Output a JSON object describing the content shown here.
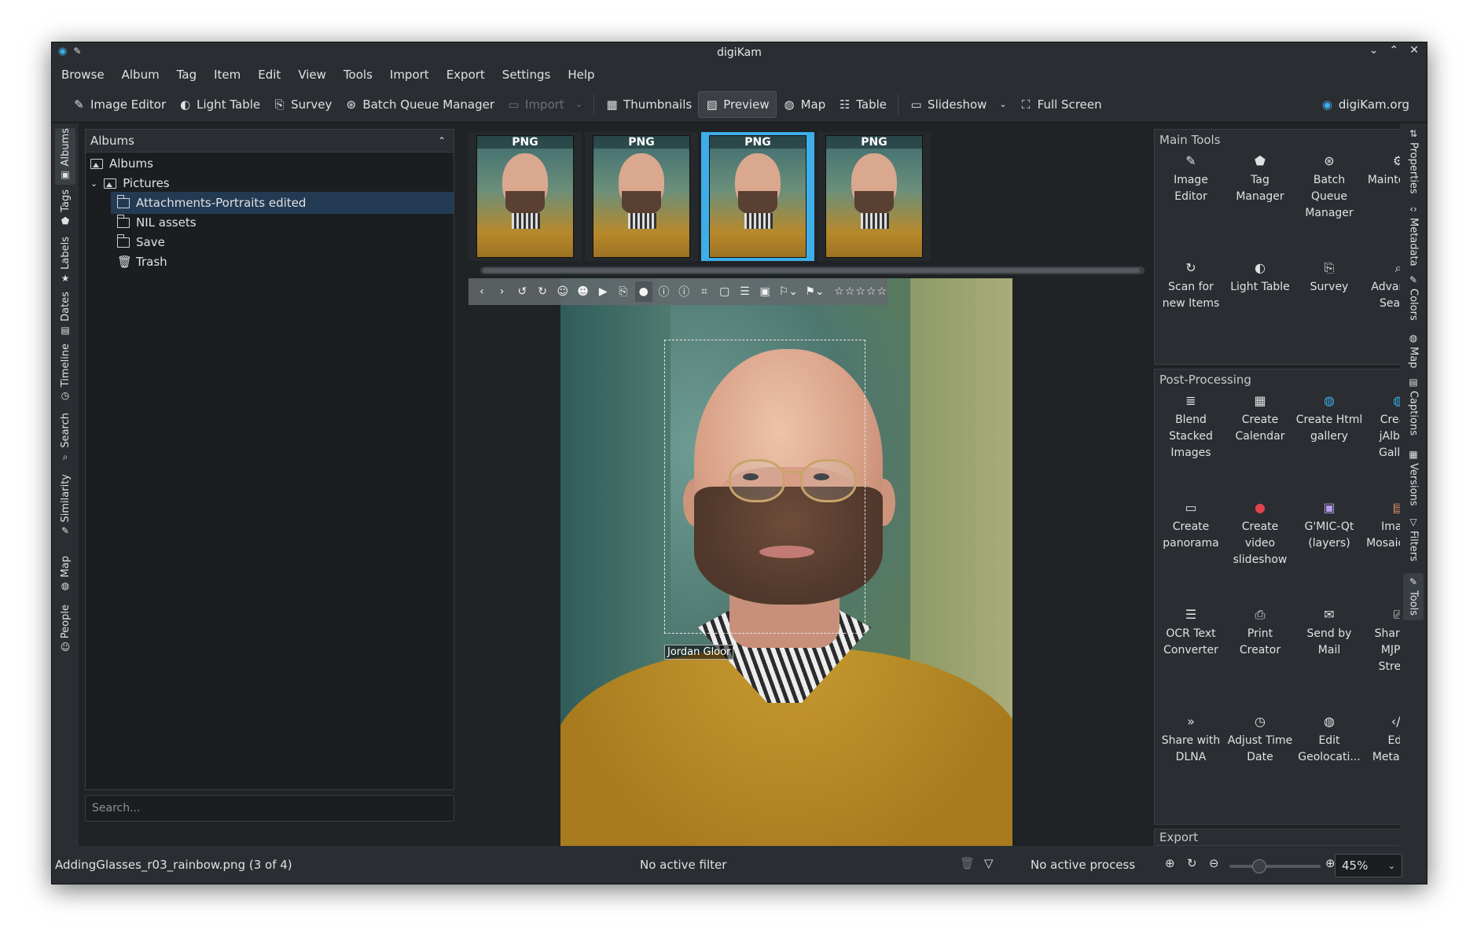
{
  "window": {
    "title": "digiKam"
  },
  "menubar": [
    "Browse",
    "Album",
    "Tag",
    "Item",
    "Edit",
    "View",
    "Tools",
    "Import",
    "Export",
    "Settings",
    "Help"
  ],
  "toolbar": {
    "image_editor": "Image Editor",
    "light_table": "Light Table",
    "survey": "Survey",
    "batch_queue": "Batch Queue Manager",
    "import": "Import",
    "thumbnails": "Thumbnails",
    "preview": "Preview",
    "map": "Map",
    "table": "Table",
    "slideshow": "Slideshow",
    "full_screen": "Full Screen",
    "website": "digiKam.org"
  },
  "left_tabs": [
    "Albums",
    "Tags",
    "Labels",
    "Dates",
    "Timeline",
    "Search",
    "Similarity",
    "Map",
    "People"
  ],
  "album_panel": {
    "header": "Albums",
    "tree": [
      "Albums",
      "Pictures",
      "Attachments-Portraits edited",
      "NIL assets",
      "Save",
      "Trash"
    ],
    "search_placeholder": "Search..."
  },
  "thumbnails": [
    {
      "badge": "PNG",
      "selected": false
    },
    {
      "badge": "PNG",
      "selected": false
    },
    {
      "badge": "PNG",
      "selected": true
    },
    {
      "badge": "PNG",
      "selected": false
    }
  ],
  "preview": {
    "face_label": "Jordan Gloor",
    "rating_stars": "☆☆☆☆☆"
  },
  "right_panel": {
    "main_tools": {
      "header": "Main Tools",
      "items": [
        {
          "label": "Image Editor",
          "icon": "✎"
        },
        {
          "label": "Tag Manager",
          "icon": "⬟"
        },
        {
          "label": "Batch Queue Manager",
          "icon": "⊛"
        },
        {
          "label": "Maintena...",
          "icon": "⚙"
        },
        {
          "label": "Scan for new Items",
          "icon": "↻"
        },
        {
          "label": "Light Table",
          "icon": "◐"
        },
        {
          "label": "Survey",
          "icon": "⎘"
        },
        {
          "label": "Advanced Search",
          "icon": "⌕"
        }
      ]
    },
    "post_processing": {
      "header": "Post-Processing",
      "items": [
        {
          "label": "Blend Stacked Images",
          "icon": "≣"
        },
        {
          "label": "Create Calendar",
          "icon": "▦"
        },
        {
          "label": "Create Html gallery",
          "icon": "◍"
        },
        {
          "label": "Create jAlbum Gallery",
          "icon": "◍"
        },
        {
          "label": "Create panorama",
          "icon": "▭"
        },
        {
          "label": "Create video slideshow",
          "icon": "●"
        },
        {
          "label": "G'MIC-Qt (layers)",
          "icon": "▣"
        },
        {
          "label": "Image Mosaic Wall",
          "icon": "▤"
        },
        {
          "label": "OCR Text Converter",
          "icon": "☰"
        },
        {
          "label": "Print Creator",
          "icon": "⎙"
        },
        {
          "label": "Send by Mail",
          "icon": "✉"
        },
        {
          "label": "Share as MJPEG Stream",
          "icon": "⎚"
        },
        {
          "label": "Share with DLNA",
          "icon": "»"
        },
        {
          "label": "Adjust Time Date",
          "icon": "◷"
        },
        {
          "label": "Edit Geolocati...",
          "icon": "◍"
        },
        {
          "label": "Edit Metadata",
          "icon": "‹/›"
        }
      ]
    },
    "export": {
      "header": "Export"
    }
  },
  "right_tabs": [
    "Properties",
    "Metadata",
    "Colors",
    "Map",
    "Captions",
    "Versions",
    "Filters",
    "Tools"
  ],
  "statusbar": {
    "file": "AddingGlasses_r03_rainbow.png (3 of 4)",
    "filter": "No active filter",
    "process": "No active process",
    "zoom": "45%",
    "zoom_level": 0.3
  }
}
